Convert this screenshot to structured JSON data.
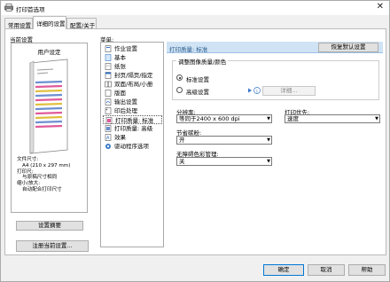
{
  "window": {
    "title": "打印首选项",
    "close_glyph": "✕"
  },
  "tabs": [
    {
      "label": "常用设置"
    },
    {
      "label": "详细的设置"
    },
    {
      "label": "配置/关于"
    }
  ],
  "left": {
    "group_label": "当前设置",
    "preview_title": "用户设定",
    "summary": {
      "size_label": "文件尺寸:",
      "size_value": "A4 (210 x 297 mm)",
      "print_label": "打印尺:",
      "print_value": "与原稿尺寸相同",
      "scale_label": "缩小/放大:",
      "scale_value": "自动配合打印尺寸"
    },
    "settings_summary_button": "设置摘要",
    "register_button": "注册当前设置..."
  },
  "menu": {
    "label": "菜单:",
    "items": [
      {
        "label": "作业设置",
        "icon": "job-icon"
      },
      {
        "label": "基本",
        "icon": "basic-icon"
      },
      {
        "label": "纸张",
        "icon": "paper-icon"
      },
      {
        "label": "封页/隔页/指定",
        "icon": "cover-icon"
      },
      {
        "label": "双面/布局/小册",
        "icon": "layout-icon"
      },
      {
        "label": "版面",
        "icon": "page-icon"
      },
      {
        "label": "输出设置",
        "icon": "output-icon"
      },
      {
        "label": "印后处理",
        "icon": "finish-icon"
      },
      {
        "label": "打印质量: 标准",
        "icon": "quality-icon"
      },
      {
        "label": "打印质量: 高级",
        "icon": "quality-adv-icon"
      },
      {
        "label": "效果",
        "icon": "effect-icon"
      },
      {
        "label": "驱动程序选项",
        "icon": "driver-icon"
      }
    ],
    "selected_index": 8
  },
  "panel": {
    "header_title": "打印质量: 标准",
    "restore_button": "恢复默认设置",
    "adjust_group": "调整图像质量/颜色",
    "radio_standard": "标准设置",
    "radio_advanced": "高级设置",
    "details_button": "详细...",
    "resolution_label": "分辨率:",
    "resolution_value": "等同于2400 x 600 dpi",
    "print_priority_label": "打印优先:",
    "print_priority_value": "速度",
    "toner_label": "节省碳粉:",
    "toner_value": "开",
    "unauthorized_label": "无障碍色彩管理:",
    "unauthorized_value": "关"
  },
  "footer": {
    "ok": "确定",
    "cancel": "取消",
    "help": "帮助"
  }
}
